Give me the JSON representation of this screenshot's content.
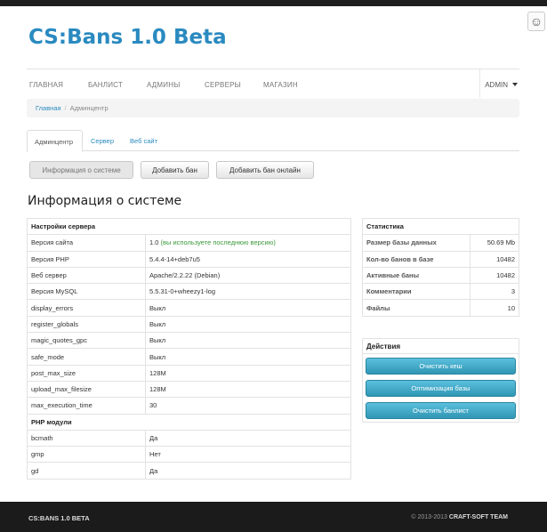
{
  "brand": "CS:Bans 1.0 Beta",
  "nav": {
    "items": [
      "ГЛАВНАЯ",
      "БАНЛИСТ",
      "АДМИНЫ",
      "СЕРВЕРЫ",
      "МАГАЗИН"
    ],
    "user": "ADMIN"
  },
  "breadcrumb": {
    "home": "Главная",
    "separator": "/",
    "current": "Админцентр"
  },
  "tabs": [
    "Админцентр",
    "Сервер",
    "Веб сайт"
  ],
  "buttons": [
    "Информация о системе",
    "Добавить бан",
    "Добавить бан онлайн"
  ],
  "section_title": "Информация о системе",
  "server_settings": {
    "header": "Настройки сервера",
    "rows": [
      {
        "key": "Версия сайта",
        "value": "1.0",
        "note": "(вы используете последнюю версию)"
      },
      {
        "key": "Версия PHP",
        "value": "5.4.4-14+deb7u5"
      },
      {
        "key": "Веб сервер",
        "value": "Apache/2.2.22 (Debian)"
      },
      {
        "key": "Версия MySQL",
        "value": "5.5.31-0+wheezy1-log"
      },
      {
        "key": "display_errors",
        "value": "Выкл"
      },
      {
        "key": "register_globals",
        "value": "Выкл"
      },
      {
        "key": "magic_quotes_gpc",
        "value": "Выкл"
      },
      {
        "key": "safe_mode",
        "value": "Выкл"
      },
      {
        "key": "post_max_size",
        "value": "128M"
      },
      {
        "key": "upload_max_filesize",
        "value": "128M"
      },
      {
        "key": "max_execution_time",
        "value": "30"
      }
    ],
    "modules_header": "PHP модули",
    "modules": [
      {
        "key": "bcmath",
        "value": "Да"
      },
      {
        "key": "gmp",
        "value": "Нет"
      },
      {
        "key": "gd",
        "value": "Да"
      }
    ]
  },
  "stats": {
    "header": "Статистика",
    "rows": [
      {
        "key": "Размер базы данных",
        "value": "50.69 Mb"
      },
      {
        "key": "Кол-во банов в базе",
        "value": "10482"
      },
      {
        "key": "Активные баны",
        "value": "10482"
      },
      {
        "key": "Комментарии",
        "value": "3"
      },
      {
        "key": "Файлы",
        "value": "10"
      }
    ]
  },
  "actions": {
    "header": "Действия",
    "buttons": [
      "Очистить кеш",
      "Оптимизация базы",
      "Очистить банлист"
    ]
  },
  "footer": {
    "left": "CS:BANS 1.0 BETA",
    "copyright": "© 2013-2013",
    "team": "CRAFT-SOFT TEAM"
  },
  "colors": {
    "accent": "#2a8ac0",
    "note": "#3a9a3a",
    "action": "#49afcd",
    "footer": "#1b1b1b"
  },
  "icons": {
    "corner": "app-logo-icon",
    "user_menu": "caret-down-icon"
  }
}
